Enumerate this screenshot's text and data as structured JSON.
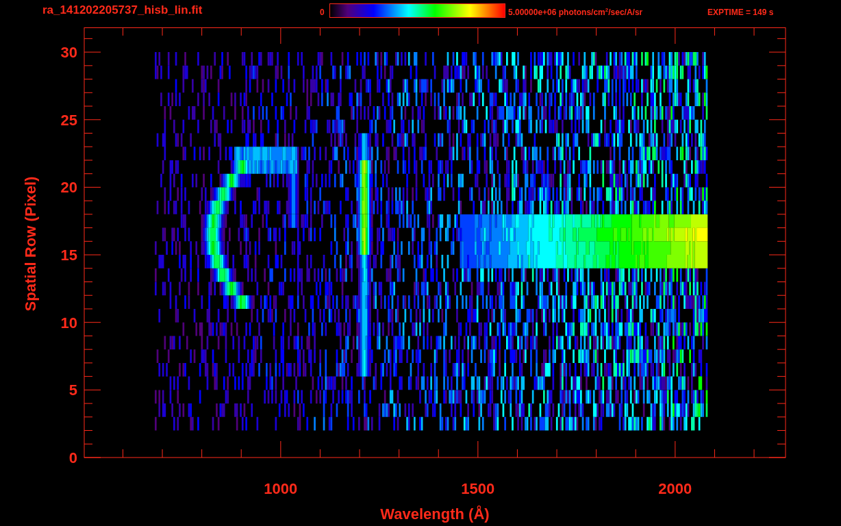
{
  "title": "ra_141202205737_hisb_lin.fit",
  "colorbar": {
    "min_label": "0",
    "max_label": "5.00000e+06 photons/cm$^{2}$/sec/A/sr"
  },
  "exptime": "EXPTIME = 149 s",
  "plot": {
    "ylabel": "Spatial Row (Pixel)",
    "xlabel": "Wavelength (Å)",
    "yticks": [
      "30",
      "25",
      "20",
      "15",
      "10",
      "5",
      "0"
    ],
    "xticks": [
      "1000",
      "1500",
      "2000"
    ]
  }
}
